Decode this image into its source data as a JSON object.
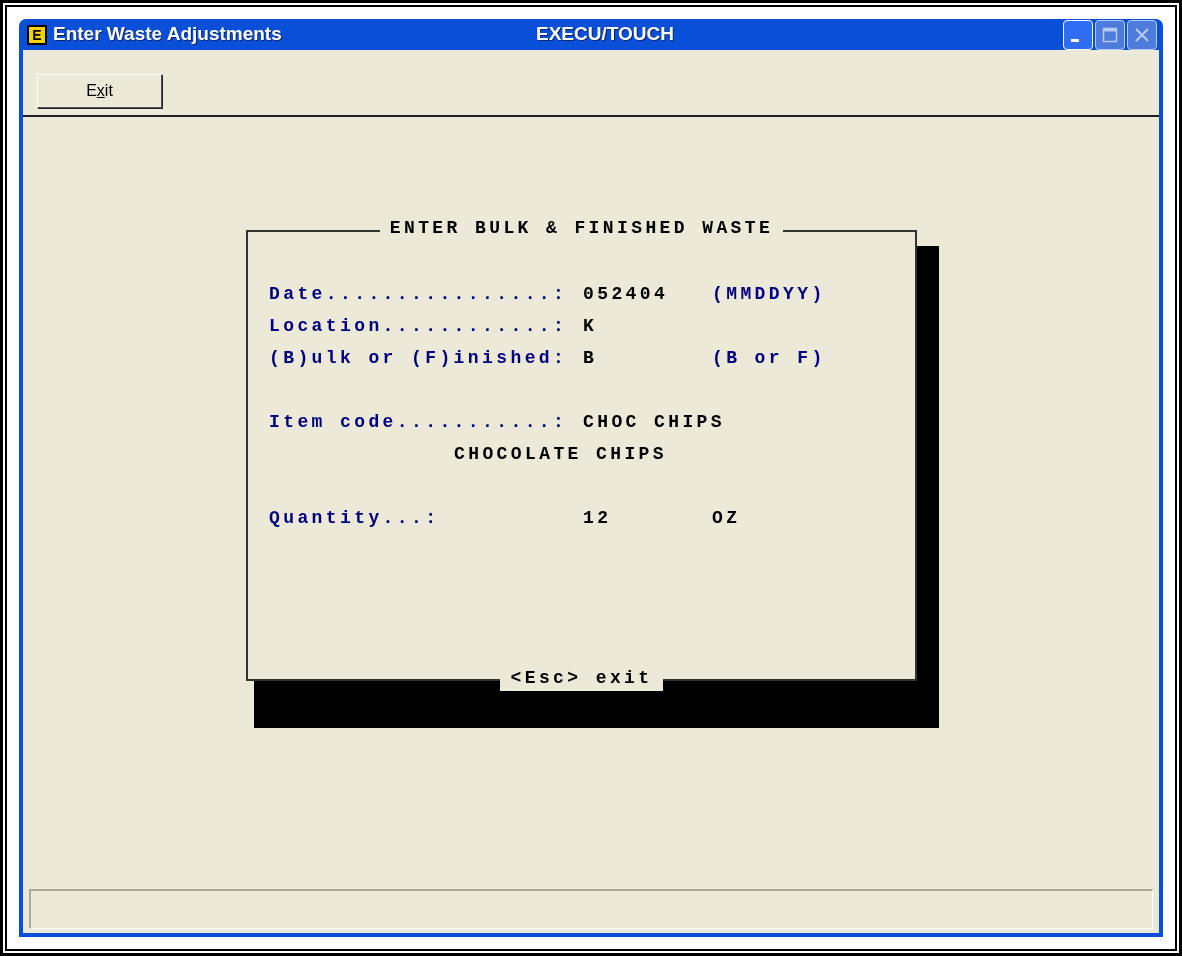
{
  "window": {
    "icon_letter": "E",
    "title": "Enter Waste Adjustments",
    "app_title": "EXECU/TOUCH",
    "controls": [
      {
        "kind": "minimize",
        "disabled": false
      },
      {
        "kind": "maximize",
        "disabled": true
      },
      {
        "kind": "close",
        "disabled": true
      }
    ]
  },
  "toolbar": {
    "buttons": [
      {
        "label_start": "E",
        "accelerator": "x",
        "label_end": "it"
      }
    ]
  },
  "dialog": {
    "title": "ENTER BULK & FINISHED WASTE",
    "footer": "<Esc> exit",
    "sections": [
      [
        {
          "kind": "field",
          "label": "Date................:",
          "value": "052404",
          "hint": "(MMDDYY)"
        },
        {
          "kind": "field",
          "label": "Location............:",
          "value": "K"
        },
        {
          "kind": "field",
          "label": "(B)ulk or (F)inished:",
          "value": "B",
          "hint": "(B or F)"
        }
      ],
      [
        {
          "kind": "field",
          "label": "Item code...........:",
          "value": "CHOC CHIPS"
        },
        {
          "kind": "description",
          "value": "CHOCOLATE CHIPS"
        }
      ],
      [
        {
          "kind": "field",
          "label": "Quantity...:",
          "value": "12",
          "unit": "OZ"
        }
      ]
    ]
  }
}
